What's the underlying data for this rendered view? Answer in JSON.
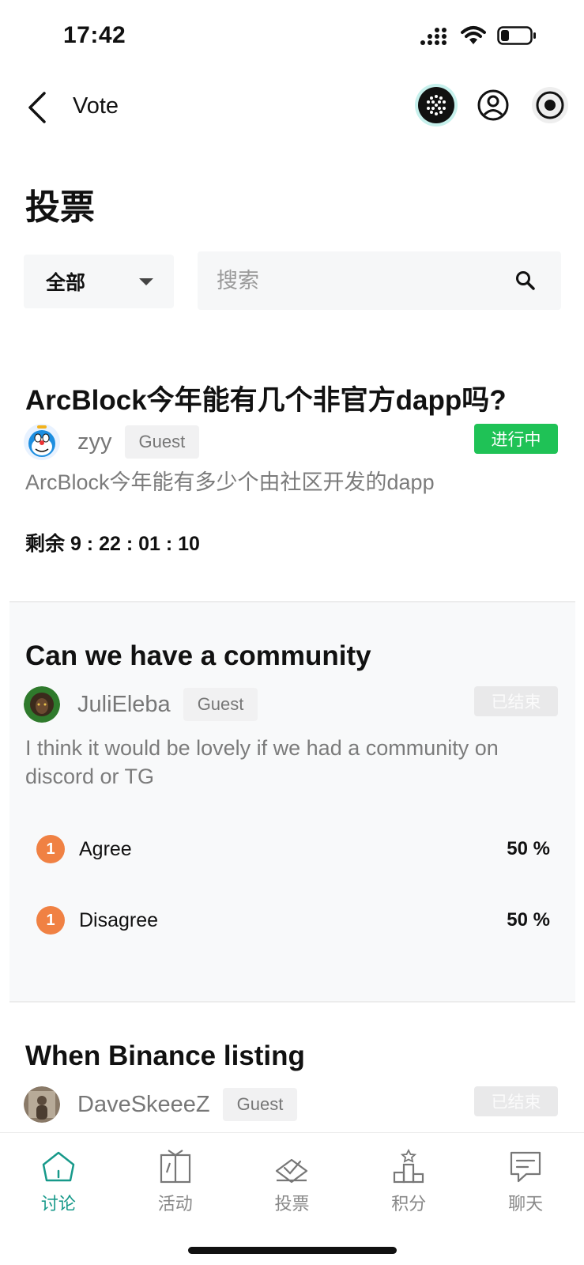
{
  "status_bar": {
    "time": "17:42"
  },
  "nav": {
    "title": "Vote"
  },
  "page": {
    "title": "投票"
  },
  "filters": {
    "select_value": "全部",
    "search_placeholder": "搜索"
  },
  "polls": [
    {
      "title": "ArcBlock今年能有几个非官方dapp吗?",
      "author": "zyy",
      "role": "Guest",
      "status": "进行中",
      "description": "ArcBlock今年能有多少个由社区开发的dapp",
      "countdown": "剩余 9 : 22 : 01 : 10"
    },
    {
      "title": "Can we have a community",
      "author": "JuliEleba",
      "role": "Guest",
      "status": "已结束",
      "description": "I think it would be lovely if we had a community on discord or TG",
      "options": [
        {
          "rank": "1",
          "label": "Agree",
          "percent": "50 %"
        },
        {
          "rank": "1",
          "label": "Disagree",
          "percent": "50 %"
        }
      ]
    },
    {
      "title": "When Binance listing",
      "author": "DaveSkeeeZ",
      "role": "Guest",
      "status": "已结束"
    }
  ],
  "tabs": [
    {
      "label": "讨论",
      "icon": "home-icon",
      "active": true
    },
    {
      "label": "活动",
      "icon": "gift-icon",
      "active": false
    },
    {
      "label": "投票",
      "icon": "vote-icon",
      "active": false
    },
    {
      "label": "积分",
      "icon": "podium-icon",
      "active": false
    },
    {
      "label": "聊天",
      "icon": "chat-icon",
      "active": false
    }
  ],
  "colors": {
    "accent": "#17998a",
    "live": "#1fc256",
    "rank_badge": "#f08143"
  }
}
